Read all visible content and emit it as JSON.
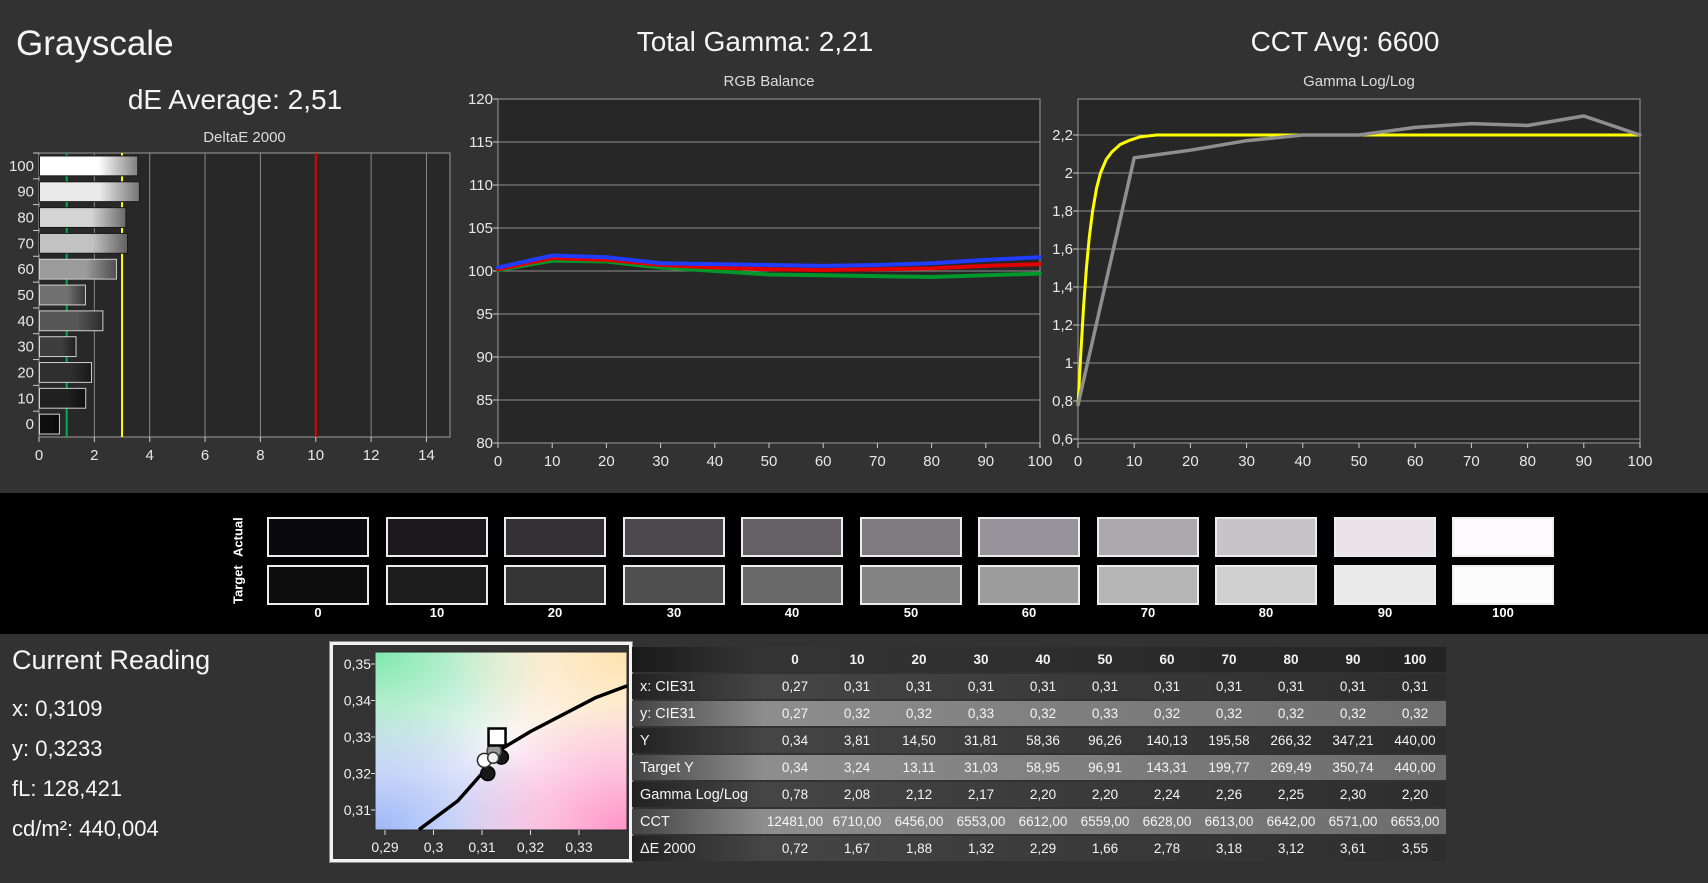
{
  "header": {
    "title": "Grayscale",
    "de_average": "dE Average: 2,51",
    "total_gamma": "Total Gamma: 2,21",
    "cct_avg": "CCT Avg: 6600"
  },
  "current_reading": {
    "title": "Current Reading",
    "x": "x: 0,3109",
    "y": "y: 0,3233",
    "fl": "fL: 128,421",
    "cdm2": "cd/m²: 440,004"
  },
  "swatches": {
    "row_labels": [
      "Actual",
      "Target"
    ],
    "steps": [
      "0",
      "10",
      "20",
      "30",
      "40",
      "50",
      "60",
      "70",
      "80",
      "90",
      "100"
    ],
    "actual_colors": [
      "#0a090e",
      "#1b191c",
      "#343136",
      "#4c494e",
      "#656066",
      "#7f7a80",
      "#98939a",
      "#aba8ae",
      "#c7c3c9",
      "#e9e3e9",
      "#fdfaff"
    ],
    "target_colors": [
      "#0d0d0d",
      "#1d1d1d",
      "#353535",
      "#4f4f4f",
      "#696969",
      "#838383",
      "#9c9c9c",
      "#b5b5b5",
      "#cfcfcf",
      "#e9e9e9",
      "#fcfcfc"
    ]
  },
  "table": {
    "columns": [
      "",
      "0",
      "10",
      "20",
      "30",
      "40",
      "50",
      "60",
      "70",
      "80",
      "90",
      "100"
    ],
    "rows": [
      {
        "label": "x: CIE31",
        "shade": "dark",
        "values": [
          "0,27",
          "0,31",
          "0,31",
          "0,31",
          "0,31",
          "0,31",
          "0,31",
          "0,31",
          "0,31",
          "0,31",
          "0,31"
        ]
      },
      {
        "label": "y: CIE31",
        "shade": "light",
        "values": [
          "0,27",
          "0,32",
          "0,32",
          "0,33",
          "0,32",
          "0,33",
          "0,32",
          "0,32",
          "0,32",
          "0,32",
          "0,32"
        ]
      },
      {
        "label": "Y",
        "shade": "dark",
        "values": [
          "0,34",
          "3,81",
          "14,50",
          "31,81",
          "58,36",
          "96,26",
          "140,13",
          "195,58",
          "266,32",
          "347,21",
          "440,00"
        ]
      },
      {
        "label": "Target Y",
        "shade": "light",
        "values": [
          "0,34",
          "3,24",
          "13,11",
          "31,03",
          "58,95",
          "96,91",
          "143,31",
          "199,77",
          "269,49",
          "350,74",
          "440,00"
        ]
      },
      {
        "label": "Gamma Log/Log",
        "shade": "dark",
        "values": [
          "0,78",
          "2,08",
          "2,12",
          "2,17",
          "2,20",
          "2,20",
          "2,24",
          "2,26",
          "2,25",
          "2,30",
          "2,20"
        ]
      },
      {
        "label": "CCT",
        "shade": "light",
        "values": [
          "12481,00",
          "6710,00",
          "6456,00",
          "6553,00",
          "6612,00",
          "6559,00",
          "6628,00",
          "6613,00",
          "6642,00",
          "6571,00",
          "6653,00"
        ]
      },
      {
        "label": "ΔE 2000",
        "shade": "dark",
        "values": [
          "0,72",
          "1,67",
          "1,88",
          "1,32",
          "2,29",
          "1,66",
          "2,78",
          "3,18",
          "3,12",
          "3,61",
          "3,55"
        ]
      }
    ]
  },
  "chart_data": [
    {
      "id": "deltae",
      "type": "bar",
      "title": "DeltaE 2000",
      "categories": [
        100,
        90,
        80,
        70,
        60,
        50,
        40,
        30,
        20,
        10,
        0
      ],
      "values": [
        3.55,
        3.61,
        3.12,
        3.18,
        2.78,
        1.66,
        2.29,
        1.32,
        1.88,
        1.67,
        0.72
      ],
      "bar_tones": [
        "#ffffff",
        "#eaeaea",
        "#d4d4d4",
        "#c2c2c2",
        "#9b9b9b",
        "#707070",
        "#565656",
        "#3e3e3e",
        "#2f2f2f",
        "#202020",
        "#0e0e0e"
      ],
      "x_ticks": [
        0,
        2,
        4,
        6,
        8,
        10,
        12,
        14
      ],
      "xlim": [
        0,
        14.85
      ],
      "ref_lines": [
        {
          "name": "good",
          "x": 1,
          "color": "#00b050"
        },
        {
          "name": "warning",
          "x": 3,
          "color": "#ffff00"
        },
        {
          "name": "bad",
          "x": 10,
          "color": "#e80000"
        }
      ]
    },
    {
      "id": "rgb_balance",
      "type": "line",
      "title": "RGB Balance",
      "x": [
        0,
        10,
        20,
        30,
        40,
        50,
        60,
        70,
        80,
        90,
        100
      ],
      "ylim": [
        80,
        120
      ],
      "y_tick_step": 5,
      "series": [
        {
          "name": "Green",
          "color": "#00972b",
          "width": 4,
          "values": [
            100.1,
            101.2,
            101.1,
            100.4,
            100.0,
            99.6,
            99.5,
            99.4,
            99.3,
            99.5,
            99.7
          ]
        },
        {
          "name": "Red",
          "color": "#e00000",
          "width": 4,
          "values": [
            100.2,
            101.5,
            101.3,
            100.7,
            100.4,
            100.2,
            100.1,
            100.2,
            100.3,
            100.6,
            100.8
          ]
        },
        {
          "name": "Blue",
          "color": "#1f3cff",
          "width": 4,
          "values": [
            100.4,
            101.8,
            101.6,
            100.9,
            100.8,
            100.7,
            100.6,
            100.7,
            100.9,
            101.3,
            101.6
          ]
        }
      ]
    },
    {
      "id": "gamma_loglog",
      "type": "line",
      "title": "Gamma Log/Log",
      "y_ticks": [
        {
          "label": "2,2",
          "v": 2.2
        },
        {
          "label": "2",
          "v": 2.0
        },
        {
          "label": "1,8",
          "v": 1.8
        },
        {
          "label": "1,6",
          "v": 1.6
        },
        {
          "label": "1,4",
          "v": 1.4
        },
        {
          "label": "1,2",
          "v": 1.2
        },
        {
          "label": "1",
          "v": 1.0
        },
        {
          "label": "0,8",
          "v": 0.8
        },
        {
          "label": "0,6",
          "v": 0.6
        }
      ],
      "x_ticks": [
        0,
        10,
        20,
        30,
        40,
        50,
        60,
        70,
        80,
        90,
        100
      ],
      "series": [
        {
          "name": "Target",
          "color": "#ffff00",
          "width": 3,
          "points": [
            [
              0,
              0.78
            ],
            [
              0.5,
              1.05
            ],
            [
              1,
              1.3
            ],
            [
              1.5,
              1.5
            ],
            [
              2,
              1.66
            ],
            [
              2.6,
              1.8
            ],
            [
              3.3,
              1.92
            ],
            [
              4,
              2.0
            ],
            [
              5,
              2.07
            ],
            [
              6,
              2.11
            ],
            [
              7.5,
              2.15
            ],
            [
              9,
              2.17
            ],
            [
              11,
              2.19
            ],
            [
              14,
              2.2
            ],
            [
              30,
              2.2
            ],
            [
              50,
              2.2
            ],
            [
              70,
              2.2
            ],
            [
              100,
              2.2
            ]
          ]
        },
        {
          "name": "Measured",
          "color": "#8f8f8f",
          "width": 3.5,
          "points": [
            [
              0,
              0.78
            ],
            [
              10,
              2.08
            ],
            [
              20,
              2.12
            ],
            [
              30,
              2.17
            ],
            [
              40,
              2.2
            ],
            [
              50,
              2.2
            ],
            [
              60,
              2.24
            ],
            [
              70,
              2.26
            ],
            [
              80,
              2.25
            ],
            [
              90,
              2.3
            ],
            [
              100,
              2.2
            ]
          ]
        }
      ]
    },
    {
      "id": "cie",
      "type": "scatter",
      "title": "CIE xy chromaticity",
      "x_ticks": [
        {
          "label": "0,29",
          "v": 0.29
        },
        {
          "label": "0,3",
          "v": 0.3
        },
        {
          "label": "0,31",
          "v": 0.31
        },
        {
          "label": "0,32",
          "v": 0.32
        },
        {
          "label": "0,33",
          "v": 0.33
        }
      ],
      "y_ticks": [
        {
          "label": "0,35",
          "v": 0.35
        },
        {
          "label": "0,34",
          "v": 0.34
        },
        {
          "label": "0,33",
          "v": 0.33
        },
        {
          "label": "0,32",
          "v": 0.32
        },
        {
          "label": "0,31",
          "v": 0.31
        }
      ],
      "locus": [
        [
          0.297,
          0.3046
        ],
        [
          0.305,
          0.3125
        ],
        [
          0.31,
          0.32
        ],
        [
          0.3131,
          0.326
        ],
        [
          0.32,
          0.3315
        ],
        [
          0.3333,
          0.3407
        ],
        [
          0.3399,
          0.344
        ]
      ],
      "target": {
        "x": 0.3131,
        "y": 0.33
      },
      "points": [
        {
          "x": 0.314,
          "y": 0.3245,
          "fill": "#181818",
          "stroke": "#000000",
          "r": 7
        },
        {
          "x": 0.3125,
          "y": 0.3262,
          "fill": "#9a9a9a",
          "stroke": "#4a4a4a",
          "r": 7
        },
        {
          "x": 0.3112,
          "y": 0.32,
          "fill": "#181818",
          "stroke": "#000000",
          "r": 7
        },
        {
          "x": 0.3105,
          "y": 0.3236,
          "fill": "#ffffff",
          "stroke": "#2a2a2a",
          "r": 7
        },
        {
          "x": 0.3123,
          "y": 0.3243,
          "fill": "#f0f0f0",
          "stroke": "#3a3a3a",
          "r": 5.5
        }
      ]
    }
  ]
}
